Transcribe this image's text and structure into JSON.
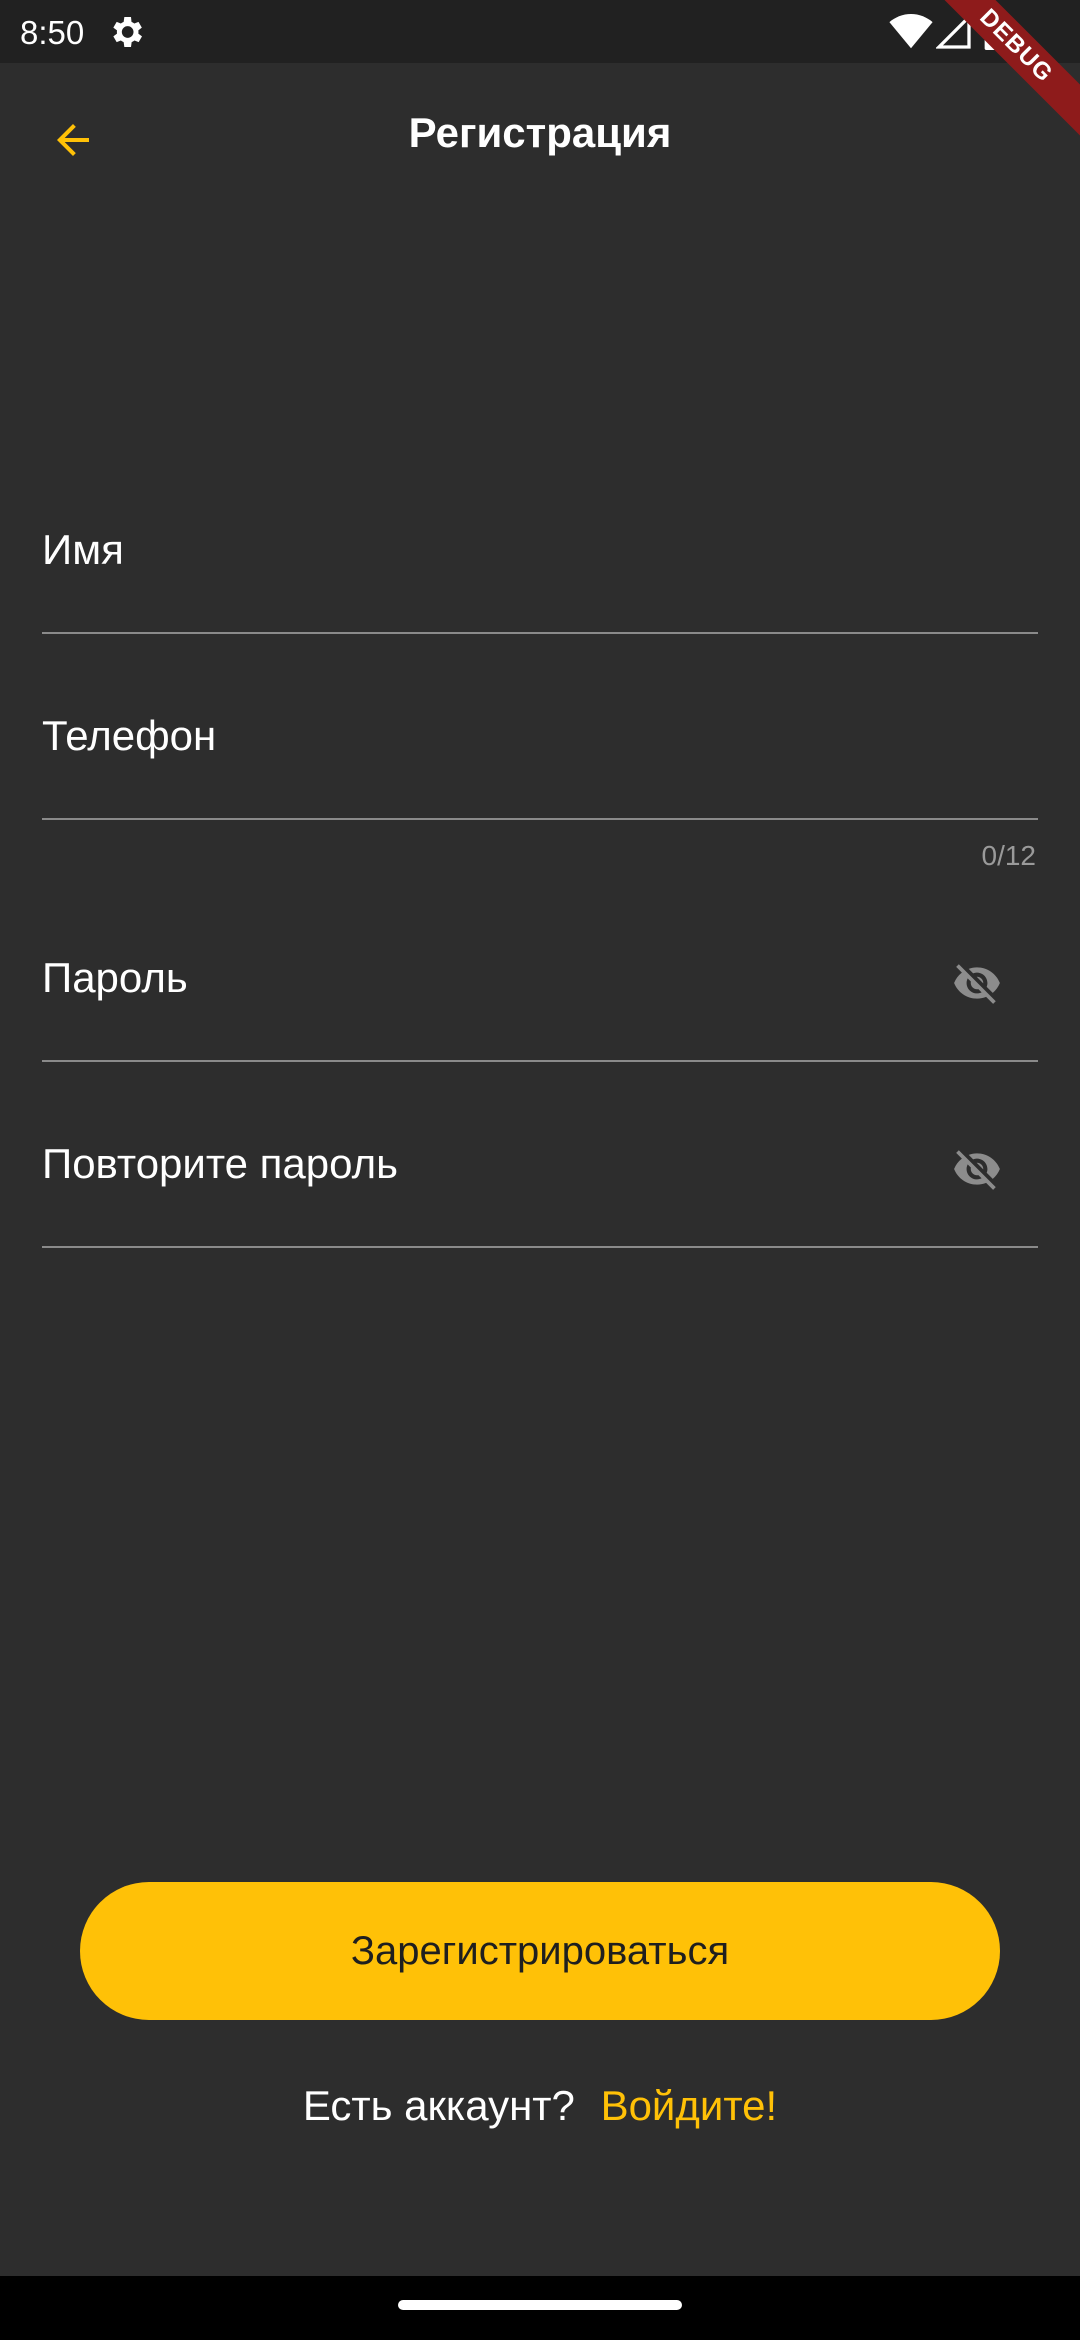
{
  "status_bar": {
    "time": "8:50",
    "debug_label": "DEBUG"
  },
  "header": {
    "title": "Регистрация"
  },
  "form": {
    "name_label": "Имя",
    "phone_label": "Телефон",
    "phone_counter": "0/12",
    "password_label": "Пароль",
    "repeat_password_label": "Повторите пароль"
  },
  "actions": {
    "register_label": "Зарегистрироваться",
    "have_account_text": "Есть аккаунт?",
    "login_link": "Войдите!"
  },
  "colors": {
    "background": "#2d2d2d",
    "accent": "#ffc107",
    "status_bar": "#212121"
  },
  "icons": {
    "back": "arrow-left-icon",
    "visibility": "eye-off-icon",
    "settings": "gear-icon"
  }
}
